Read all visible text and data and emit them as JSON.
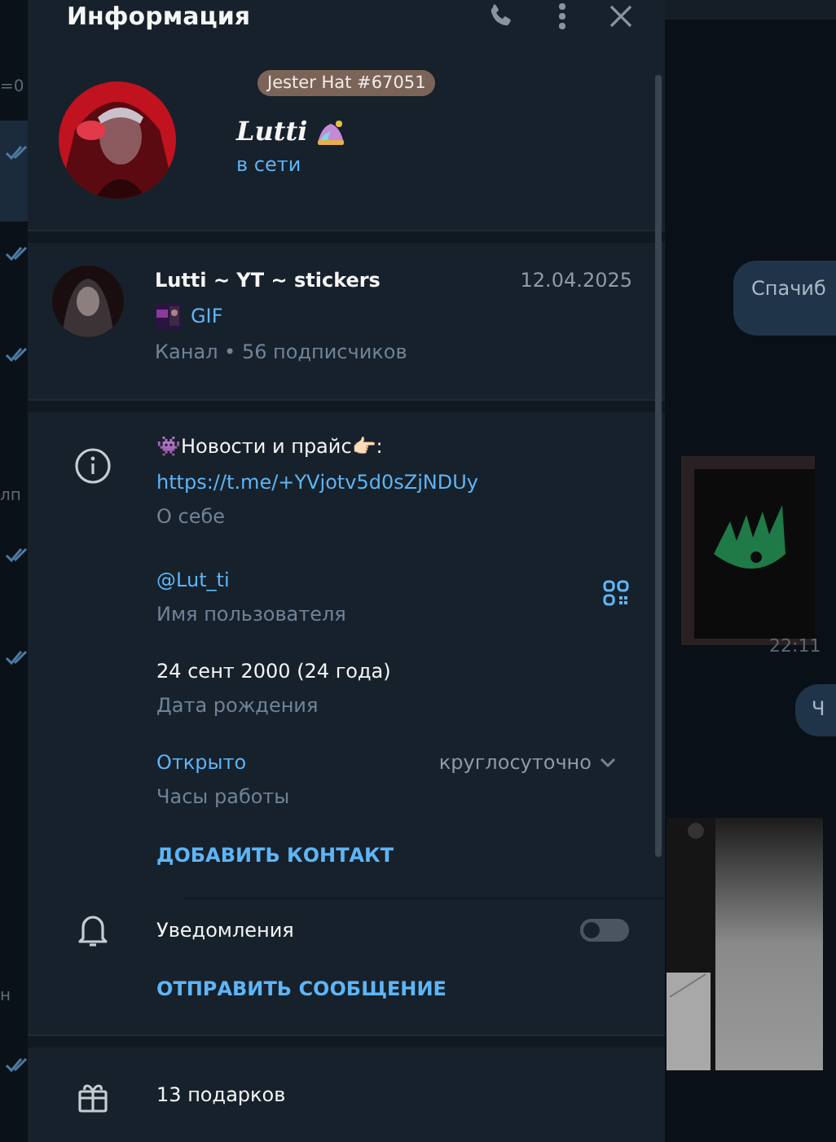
{
  "panel": {
    "title": "Информация"
  },
  "profile": {
    "badge": "Jester Hat #67051",
    "name": "Lutti",
    "status": "в сети"
  },
  "channel": {
    "name": "Lutti ~ YT ~ stickers",
    "date": "12.04.2025",
    "preview": "GIF",
    "meta": "Канал • 56 подписчиков"
  },
  "bio": {
    "text": "👾Новости и прайс👉🏻:",
    "link": "https://t.me/+YVjotv5d0sZjNDUy",
    "label": "О себе"
  },
  "username": {
    "value": "@Lut_ti",
    "label": "Имя пользователя"
  },
  "birthday": {
    "value": "24 сент 2000 (24 года)",
    "label": "Дата рождения"
  },
  "hours": {
    "status": "Открыто",
    "value": "круглосуточно",
    "label": "Часы работы"
  },
  "add_contact": "ДОБАВИТЬ КОНТАКТ",
  "notifications": {
    "label": "Уведомления",
    "on": false
  },
  "send_message": "ОТПРАВИТЬ СООБЩЕНИЕ",
  "gifts": "13 подарков",
  "background": {
    "left_fragments": [
      "=0",
      "лп",
      "н"
    ],
    "bubble": "Спачиб",
    "time": "22:11",
    "bubble_2": "Ч"
  }
}
